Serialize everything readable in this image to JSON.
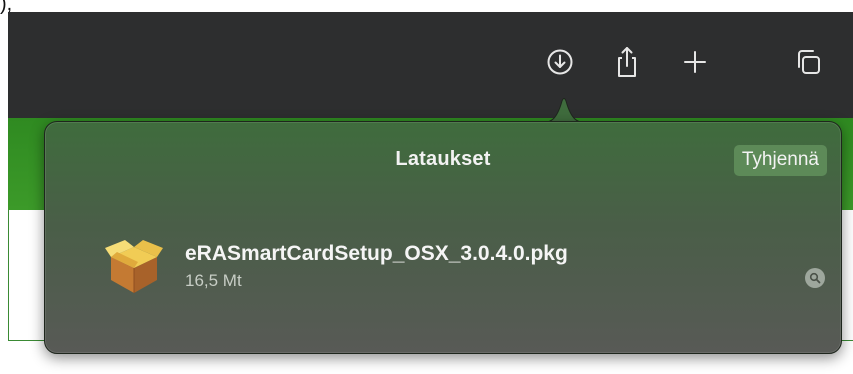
{
  "toolbar": {
    "buttons": [
      {
        "name": "downloads-icon"
      },
      {
        "name": "share-icon"
      },
      {
        "name": "new-tab-icon"
      },
      {
        "name": "tab-overview-icon"
      }
    ],
    "background": "#2d2e2f"
  },
  "downloads_popover": {
    "title": "Lataukset",
    "clear_label": "Tyhjennä",
    "items": [
      {
        "icon": "package-icon",
        "file_name": "eRASmartCardSetup_OSX_3.0.4.0.pkg",
        "size": "16,5 Mt",
        "reveal_icon": "magnifier-icon"
      }
    ]
  },
  "colors": {
    "page_accent_green": "#3c9a29",
    "popover_top": "#3f6c3d",
    "popover_bottom": "#585a56",
    "clear_button": "#5d8a58"
  }
}
